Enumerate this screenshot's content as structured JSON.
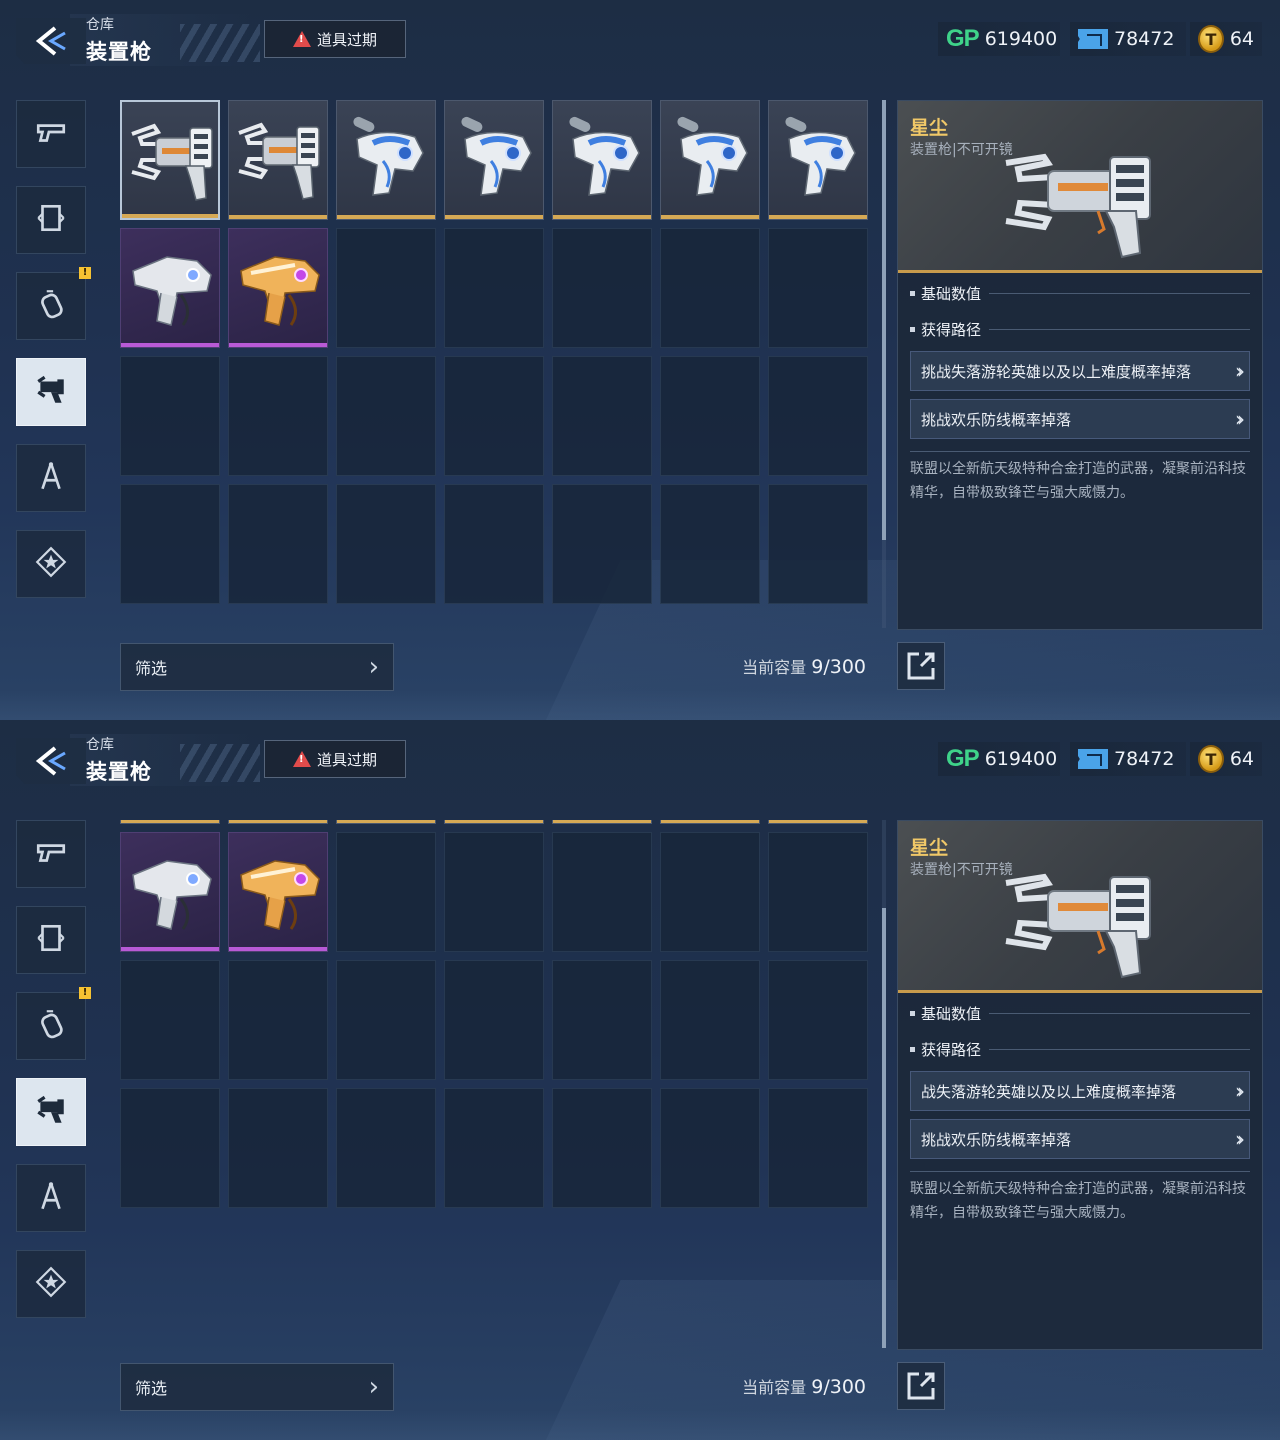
{
  "header": {
    "breadcrumb": "仓库",
    "title": "装置枪",
    "expire_label": "道具过期"
  },
  "currencies": {
    "gp_label": "GP",
    "gp_value": "619400",
    "ticket_value": "78472",
    "coin_value": "64",
    "gp_color": "#3fd38a",
    "ticket_color": "#4aa3e8",
    "coin_color": "#e0a823"
  },
  "sidebar": {
    "items": [
      {
        "icon": "pistol-icon",
        "active": false,
        "badge": false
      },
      {
        "icon": "frame-icon",
        "active": false,
        "badge": false
      },
      {
        "icon": "grenade-icon",
        "active": false,
        "badge": true
      },
      {
        "icon": "device-gun-icon",
        "active": true,
        "badge": false
      },
      {
        "icon": "compass-icon",
        "active": false,
        "badge": false
      },
      {
        "icon": "star-badge-icon",
        "active": false,
        "badge": false
      }
    ],
    "badge_text": "!"
  },
  "inventory": {
    "items": [
      {
        "name": "星尘",
        "rarity": "gold",
        "icon": "claw-gun-icon",
        "selected": true
      },
      {
        "name": "星尘",
        "rarity": "gold",
        "icon": "claw-gun-icon",
        "selected": false
      },
      {
        "name": "",
        "rarity": "gold",
        "icon": "blue-cannon-icon",
        "selected": false
      },
      {
        "name": "",
        "rarity": "gold",
        "icon": "blue-cannon-icon",
        "selected": false
      },
      {
        "name": "",
        "rarity": "gold",
        "icon": "blue-cannon-icon",
        "selected": false
      },
      {
        "name": "",
        "rarity": "gold",
        "icon": "blue-cannon-icon",
        "selected": false
      },
      {
        "name": "",
        "rarity": "gold",
        "icon": "blue-cannon-icon",
        "selected": false
      },
      {
        "name": "",
        "rarity": "purple",
        "icon": "silver-blaster-icon",
        "selected": false
      },
      {
        "name": "",
        "rarity": "purple",
        "icon": "orange-blaster-icon",
        "selected": false
      }
    ],
    "total_slots": 28,
    "filter_label": "筛选",
    "capacity_label": "当前容量",
    "capacity_value": "9/300"
  },
  "detail": {
    "name": "星尘",
    "type": "装置枪|不可开镜",
    "section_stats": "基础数值",
    "section_routes": "获得路径",
    "routes_screen1": [
      "挑战失落游轮英雄以及以上难度概率掉落",
      "挑战欢乐防线概率掉落"
    ],
    "routes_screen2": [
      "战失落游轮英雄以及以上难度概率掉落",
      "挑战欢乐防线概率掉落"
    ],
    "description": "联盟以全新航天级特种合金打造的武器，凝聚前沿科技精华，自带极致锋芒与强大威慑力。",
    "accent_color": "#c89b4c"
  }
}
